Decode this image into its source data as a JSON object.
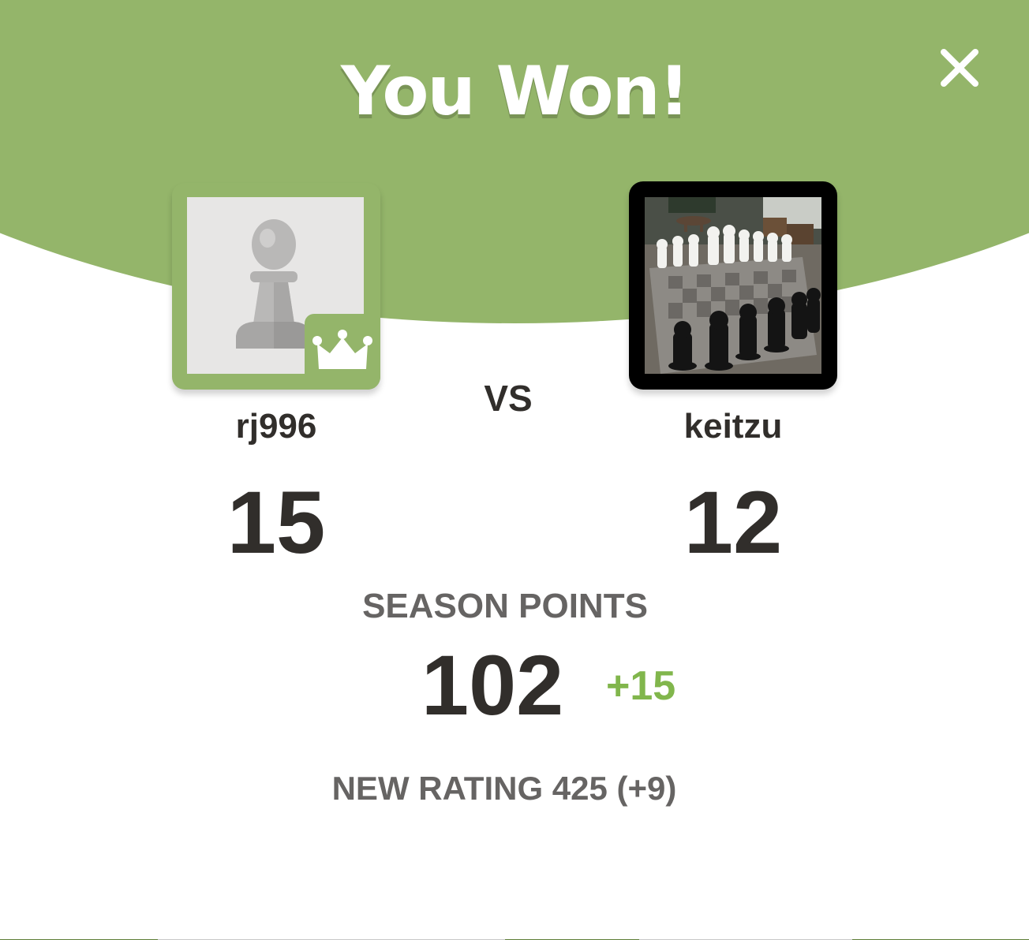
{
  "modal": {
    "title": "You Won!",
    "close_icon": "close-icon"
  },
  "players": {
    "left": {
      "username": "rj996",
      "score": "15",
      "avatar_icon": "pawn-icon",
      "badge_icon": "crown-icon"
    },
    "right": {
      "username": "keitzu",
      "score": "12",
      "avatar_icon": "chess-set-photo"
    }
  },
  "vs_label": "VS",
  "season": {
    "label": "SEASON POINTS",
    "points": "102",
    "gain": "+15"
  },
  "rating": {
    "text": "NEW RATING 425 (+9)"
  },
  "colors": {
    "accent_green": "#94b56a",
    "positive_green": "#81b64c",
    "text_dark": "#312e2b",
    "text_gray": "#666463"
  }
}
